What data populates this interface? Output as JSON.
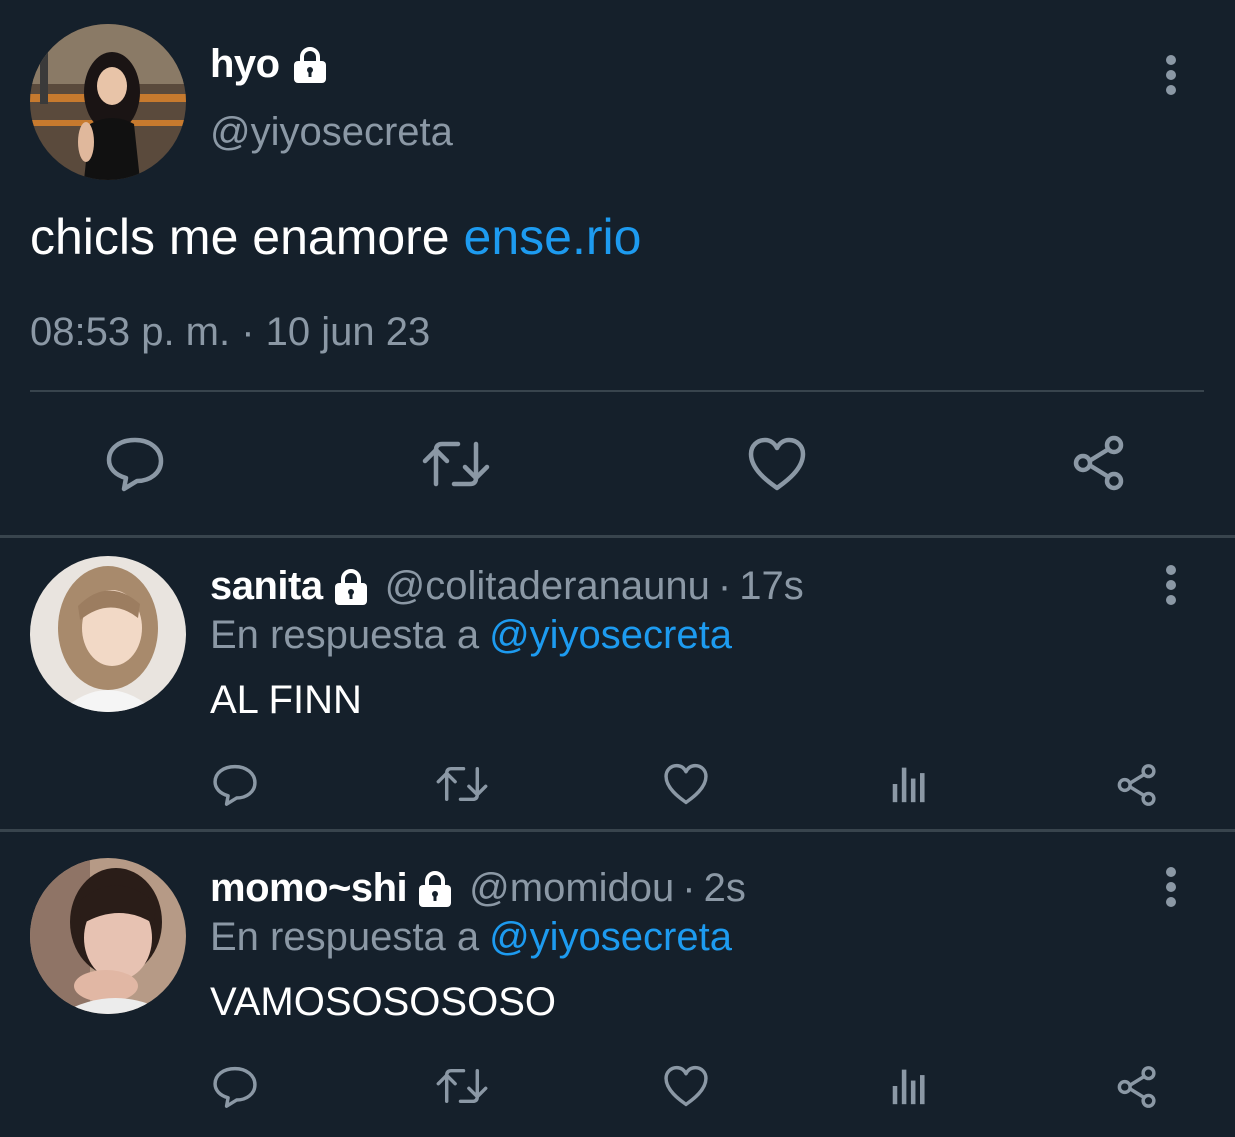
{
  "tweet": {
    "name": "hyo",
    "handle": "@yiyosecreta",
    "text": "chicls me enamore",
    "link": "ense.rio",
    "timestamp": "08:53 p. m. · 10 jun 23",
    "icons": {
      "lock": "lock-icon",
      "more": "more-vertical-icon",
      "reply": "reply-icon",
      "retweet": "retweet-icon",
      "like": "heart-icon",
      "share": "share-icon"
    }
  },
  "replies": [
    {
      "name": "sanita",
      "handle": "@colitaderanaunu",
      "separator": "·",
      "time": "17s",
      "replying_prefix": "En respuesta a",
      "replying_to": "@yiyosecreta",
      "text": "AL FINN"
    },
    {
      "name": "momo~shi",
      "handle": "@momidou",
      "separator": "·",
      "time": "2s",
      "replying_prefix": "En respuesta a",
      "replying_to": "@yiyosecreta",
      "text": "VAMOSOSOSOSO"
    }
  ],
  "colors": {
    "background": "#15202b",
    "text": "#ffffff",
    "secondary": "#8b98a5",
    "accent": "#1d9bf0",
    "divider": "#38444d"
  }
}
